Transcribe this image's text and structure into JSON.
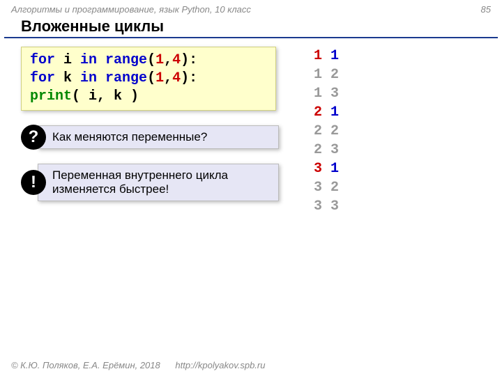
{
  "header": {
    "course": "Алгоритмы и программирование, язык Python, 10 класс",
    "page": "85"
  },
  "title": "Вложенные циклы",
  "code": {
    "l1a": "for",
    "l1b": " i ",
    "l1c": "in",
    "l1d": " range",
    "l1e": "(",
    "l1f": "1",
    "l1g": ",",
    "l1h": "4",
    "l1i": "):",
    "l2pad": "  ",
    "l2a": "for",
    "l2b": " k ",
    "l2c": "in",
    "l2d": " range",
    "l2e": "(",
    "l2f": "1",
    "l2g": ",",
    "l2h": "4",
    "l2i": "):",
    "l3pad": "    ",
    "l3a": "print",
    "l3b": "( i, k )"
  },
  "callouts": {
    "q_badge": "?",
    "q_text": "Как меняются переменные?",
    "e_badge": "!",
    "e_text": "Переменная внутреннего цикла изменяется быстрее!"
  },
  "output": [
    {
      "i": "1",
      "k": "1",
      "dimmed": false
    },
    {
      "i": "1",
      "k": "2",
      "dimmed": true
    },
    {
      "i": "1",
      "k": "3",
      "dimmed": true
    },
    {
      "i": "2",
      "k": "1",
      "dimmed": false
    },
    {
      "i": "2",
      "k": "2",
      "dimmed": true
    },
    {
      "i": "2",
      "k": "3",
      "dimmed": true
    },
    {
      "i": "3",
      "k": "1",
      "dimmed": false
    },
    {
      "i": "3",
      "k": "2",
      "dimmed": true
    },
    {
      "i": "3",
      "k": "3",
      "dimmed": true
    }
  ],
  "footer": {
    "copy": "© К.Ю. Поляков, Е.А. Ерёмин, 2018",
    "url": "http://kpolyakov.spb.ru"
  }
}
